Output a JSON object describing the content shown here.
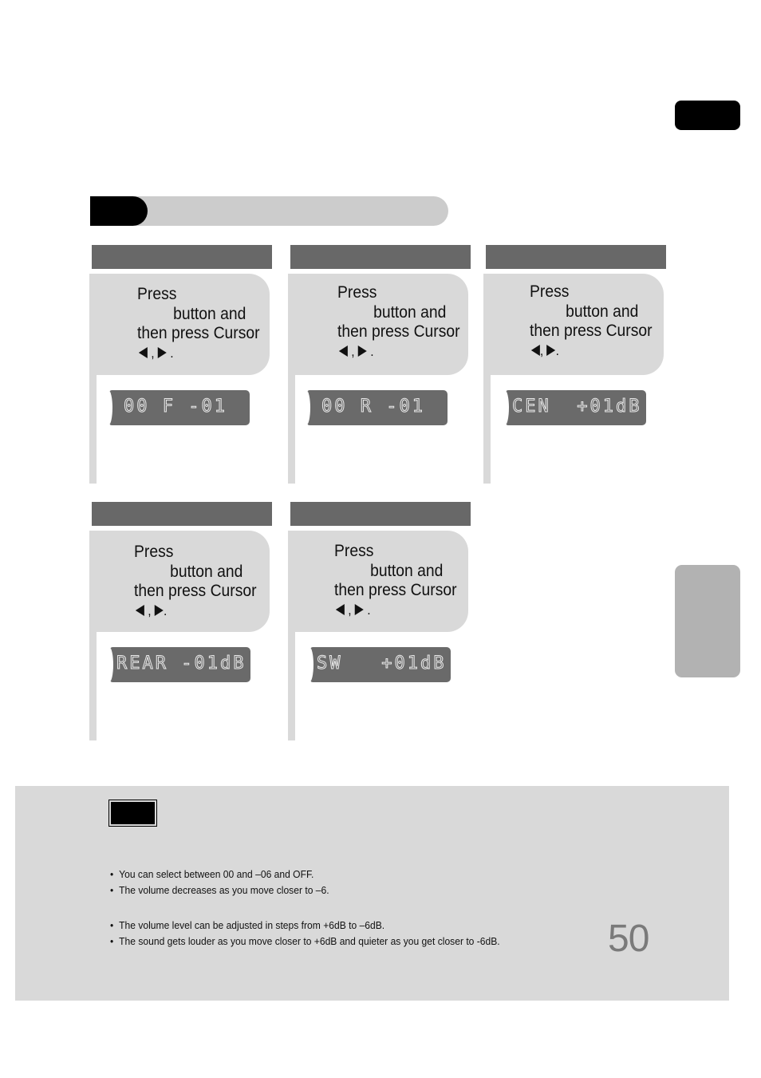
{
  "page": {
    "page_number": "50"
  },
  "cards": [
    {
      "line1": "Press",
      "line2": "button and",
      "line3": "then press Cursor",
      "sep": " , ",
      "end": " .",
      "display": "00 F -01"
    },
    {
      "line1": "Press",
      "line2": "button and",
      "line3": "then press Cursor",
      "sep": " , ",
      "end": " .",
      "display": "00 R -01"
    },
    {
      "line1": "Press",
      "line2": "button and",
      "line3": "then press Cursor",
      "sep": ", ",
      "end": ".",
      "display": "CEN  +01dB"
    },
    {
      "line1": "Press",
      "line2": "button and",
      "line3": "then press Cursor",
      "sep": " , ",
      "end": ".",
      "display": "REAR -01dB"
    },
    {
      "line1": "Press",
      "line2": "button and",
      "line3": "then press Cursor",
      "sep": " , ",
      "end": " .",
      "display": "SW   +01dB"
    }
  ],
  "notes": {
    "group1": [
      "You can select between 00 and –06 and OFF.",
      "The volume decreases as you move closer to –6."
    ],
    "group2": [
      "The volume level can be adjusted in steps from +6dB to –6dB.",
      "The sound gets louder as you move closer to +6dB and quieter as you get closer to -6dB."
    ]
  }
}
